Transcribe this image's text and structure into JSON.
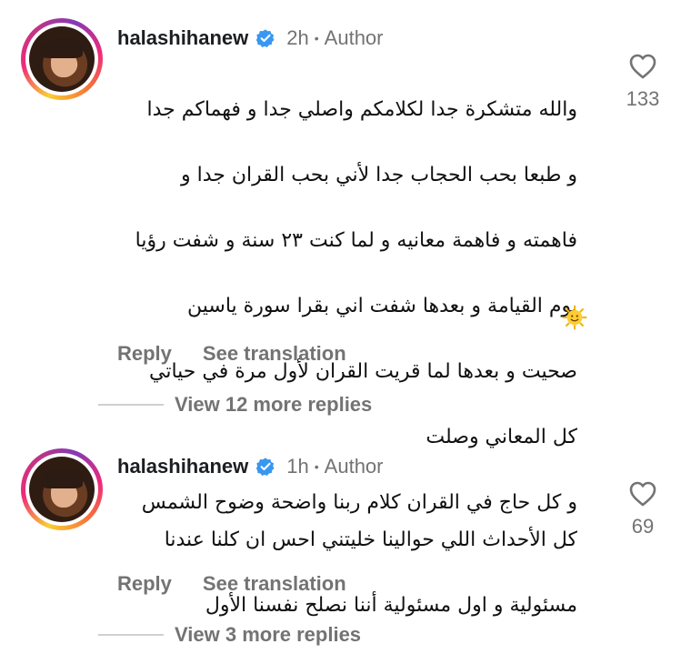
{
  "comments": [
    {
      "username": "halashihanew",
      "time": "2h",
      "separator": "•",
      "author_label": "Author",
      "text_lines": [
        "والله متشكرة جدا لكلامكم واصلي جدا و فهماكم جدا",
        "و طبعا بحب الحجاب جدا لأني بحب القران جدا و",
        "فاهمته و فاهمة معانيه و لما كنت ٢٣ سنة و شفت رؤيا",
        "يوم القيامة و بعدها شفت اني بقرا سورة ياسين",
        "صحيت و بعدها لما قريت القران لأول مرة في حياتي",
        "كل المعاني وصلت",
        "و كل حاج في القران كلام ربنا واضحة وضوح الشمس"
      ],
      "emoji": "🌞",
      "like_count": "133",
      "reply_label": "Reply",
      "translation_label": "See translation",
      "more_replies_label": "View 12 more replies"
    },
    {
      "username": "halashihanew",
      "time": "1h",
      "separator": "•",
      "author_label": "Author",
      "text_lines": [
        "كل الأحداث اللي حوالينا خليتني احس ان كلنا عندنا",
        "مسئولية و اول مسئولية أننا نصلح نفسنا الأول"
      ],
      "like_count": "69",
      "reply_label": "Reply",
      "translation_label": "See translation",
      "more_replies_label": "View 3 more replies"
    }
  ],
  "icons": {
    "verified": "verified-badge-icon",
    "heart": "heart-outline-icon",
    "sun": "sun-face-emoji"
  },
  "colors": {
    "verified_blue": "#3897f0",
    "muted_text": "#737373",
    "primary_text": "#111111"
  }
}
